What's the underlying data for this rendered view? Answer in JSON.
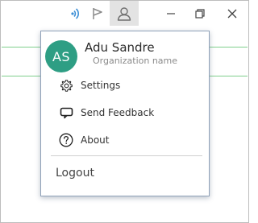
{
  "titlebar": {
    "icons": [
      "wifi-signal-icon",
      "flag-icon",
      "user-account-icon",
      "minimize-icon",
      "restore-icon",
      "close-icon"
    ]
  },
  "account_menu": {
    "avatar_initials": "AS",
    "avatar_color": "#2e9e84",
    "user_name": "Adu Sandre",
    "organization": "Organization name",
    "items": [
      {
        "label": "Settings",
        "icon": "gear-icon"
      },
      {
        "label": "Send Feedback",
        "icon": "feedback-icon"
      },
      {
        "label": "About",
        "icon": "help-icon"
      }
    ],
    "logout_label": "Logout"
  },
  "colors": {
    "wifi_icon": "#3c8fd6",
    "guide_lines": "#7fcf8c",
    "menu_border": "#8fa1b8"
  }
}
